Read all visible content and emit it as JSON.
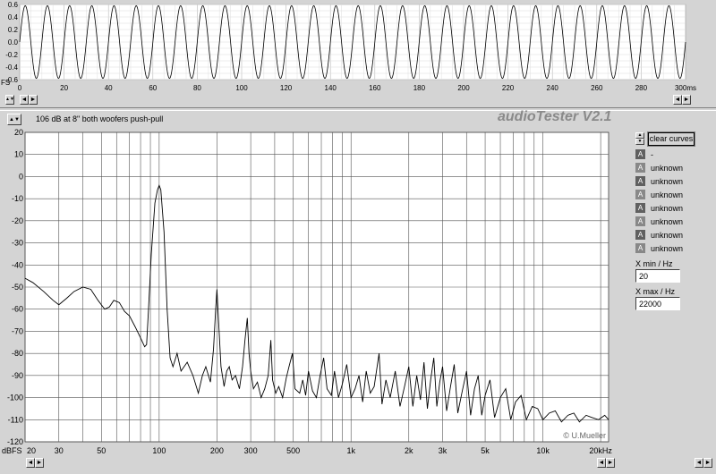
{
  "app": {
    "title": "audioTester V2.1",
    "chart_title": "106 dB at 8\" both woofers push-pull",
    "credit": "© U.Mueller"
  },
  "controls": {
    "clear_curves": "clear curves",
    "xmin_label": "X min / Hz",
    "xmin_value": "20",
    "xmax_label": "X max / Hz",
    "xmax_value": "22000"
  },
  "curves": [
    {
      "label": "-"
    },
    {
      "label": "unknown"
    },
    {
      "label": "unknown"
    },
    {
      "label": "unknown"
    },
    {
      "label": "unknown"
    },
    {
      "label": "unknown"
    },
    {
      "label": "unknown"
    },
    {
      "label": "unknown"
    }
  ],
  "icons": {
    "curve_toggle": "A",
    "scroll_left": "◄",
    "scroll_right": "►",
    "spin": "▲▼"
  },
  "chart_data": [
    {
      "type": "line",
      "name": "time-domain",
      "xunit": "300ms",
      "ylabel_top": "FS 0.6",
      "ylim": [
        -0.6,
        0.6
      ],
      "xlim": [
        0,
        300
      ],
      "yticks": [
        "0.6",
        "0.4",
        "0.2",
        "0.0",
        "-0.2",
        "-0.4",
        "-0.6"
      ],
      "xticks": [
        "0",
        "20",
        "40",
        "60",
        "80",
        "100",
        "120",
        "140",
        "160",
        "180",
        "200",
        "220",
        "240",
        "260",
        "280",
        "300ms"
      ],
      "signal": {
        "amplitude": 0.58,
        "frequency_hz": 100
      }
    },
    {
      "type": "line",
      "name": "spectrum",
      "xscale": "log",
      "xlim": [
        20,
        22000
      ],
      "ylim": [
        -120,
        20
      ],
      "ylabel": "dBFS",
      "yticks": [
        "20",
        "10",
        "0",
        "-10",
        "-20",
        "-30",
        "-40",
        "-50",
        "-60",
        "-70",
        "-80",
        "-90",
        "-100",
        "-110",
        "-120"
      ],
      "xtick_labels": [
        {
          "v": 20,
          "t": "20"
        },
        {
          "v": 30,
          "t": "30"
        },
        {
          "v": 50,
          "t": "50"
        },
        {
          "v": 100,
          "t": "100"
        },
        {
          "v": 200,
          "t": "200"
        },
        {
          "v": 300,
          "t": "300"
        },
        {
          "v": 500,
          "t": "500"
        },
        {
          "v": 1000,
          "t": "1k"
        },
        {
          "v": 2000,
          "t": "2k"
        },
        {
          "v": 3000,
          "t": "3k"
        },
        {
          "v": 5000,
          "t": "5k"
        },
        {
          "v": 10000,
          "t": "10k"
        },
        {
          "v": 20000,
          "t": "20kHz"
        }
      ],
      "points": [
        [
          20,
          -46
        ],
        [
          22,
          -48
        ],
        [
          25,
          -52
        ],
        [
          28,
          -56
        ],
        [
          30,
          -58
        ],
        [
          33,
          -55
        ],
        [
          36,
          -52
        ],
        [
          40,
          -50
        ],
        [
          44,
          -51
        ],
        [
          48,
          -56
        ],
        [
          52,
          -60
        ],
        [
          55,
          -59
        ],
        [
          58,
          -56
        ],
        [
          62,
          -57
        ],
        [
          66,
          -61
        ],
        [
          70,
          -63
        ],
        [
          75,
          -68
        ],
        [
          80,
          -73
        ],
        [
          84,
          -77
        ],
        [
          86,
          -76
        ],
        [
          88,
          -60
        ],
        [
          91,
          -35
        ],
        [
          95,
          -12
        ],
        [
          98,
          -6
        ],
        [
          100,
          -4
        ],
        [
          102,
          -6
        ],
        [
          106,
          -25
        ],
        [
          110,
          -60
        ],
        [
          114,
          -82
        ],
        [
          118,
          -86
        ],
        [
          124,
          -80
        ],
        [
          130,
          -88
        ],
        [
          140,
          -84
        ],
        [
          150,
          -90
        ],
        [
          160,
          -98
        ],
        [
          168,
          -90
        ],
        [
          175,
          -86
        ],
        [
          185,
          -93
        ],
        [
          192,
          -78
        ],
        [
          197,
          -60
        ],
        [
          200,
          -51
        ],
        [
          203,
          -62
        ],
        [
          210,
          -86
        ],
        [
          218,
          -95
        ],
        [
          225,
          -88
        ],
        [
          232,
          -86
        ],
        [
          240,
          -92
        ],
        [
          250,
          -90
        ],
        [
          262,
          -96
        ],
        [
          272,
          -86
        ],
        [
          280,
          -74
        ],
        [
          288,
          -64
        ],
        [
          294,
          -80
        ],
        [
          300,
          -88
        ],
        [
          310,
          -96
        ],
        [
          325,
          -93
        ],
        [
          340,
          -100
        ],
        [
          355,
          -96
        ],
        [
          370,
          -90
        ],
        [
          382,
          -74
        ],
        [
          390,
          -92
        ],
        [
          405,
          -98
        ],
        [
          420,
          -95
        ],
        [
          440,
          -100
        ],
        [
          460,
          -91
        ],
        [
          475,
          -86
        ],
        [
          495,
          -80
        ],
        [
          510,
          -96
        ],
        [
          540,
          -98
        ],
        [
          560,
          -92
        ],
        [
          580,
          -99
        ],
        [
          600,
          -88
        ],
        [
          630,
          -97
        ],
        [
          660,
          -100
        ],
        [
          690,
          -90
        ],
        [
          720,
          -82
        ],
        [
          750,
          -96
        ],
        [
          790,
          -99
        ],
        [
          820,
          -88
        ],
        [
          860,
          -100
        ],
        [
          900,
          -94
        ],
        [
          950,
          -85
        ],
        [
          1000,
          -100
        ],
        [
          1050,
          -96
        ],
        [
          1100,
          -90
        ],
        [
          1150,
          -102
        ],
        [
          1200,
          -88
        ],
        [
          1260,
          -98
        ],
        [
          1320,
          -95
        ],
        [
          1400,
          -80
        ],
        [
          1450,
          -103
        ],
        [
          1520,
          -92
        ],
        [
          1600,
          -100
        ],
        [
          1700,
          -88
        ],
        [
          1800,
          -104
        ],
        [
          1900,
          -95
        ],
        [
          2000,
          -86
        ],
        [
          2100,
          -104
        ],
        [
          2200,
          -90
        ],
        [
          2300,
          -101
        ],
        [
          2400,
          -84
        ],
        [
          2500,
          -105
        ],
        [
          2600,
          -92
        ],
        [
          2700,
          -82
        ],
        [
          2800,
          -104
        ],
        [
          2900,
          -93
        ],
        [
          3000,
          -86
        ],
        [
          3150,
          -106
        ],
        [
          3300,
          -95
        ],
        [
          3450,
          -85
        ],
        [
          3600,
          -107
        ],
        [
          3800,
          -97
        ],
        [
          4000,
          -88
        ],
        [
          4200,
          -108
        ],
        [
          4400,
          -96
        ],
        [
          4600,
          -90
        ],
        [
          4800,
          -108
        ],
        [
          5000,
          -99
        ],
        [
          5300,
          -92
        ],
        [
          5600,
          -109
        ],
        [
          6000,
          -100
        ],
        [
          6400,
          -96
        ],
        [
          6800,
          -110
        ],
        [
          7200,
          -102
        ],
        [
          7700,
          -99
        ],
        [
          8200,
          -110
        ],
        [
          8800,
          -104
        ],
        [
          9400,
          -105
        ],
        [
          10000,
          -110
        ],
        [
          10800,
          -107
        ],
        [
          11600,
          -106
        ],
        [
          12500,
          -111
        ],
        [
          13500,
          -108
        ],
        [
          14500,
          -107
        ],
        [
          15500,
          -111
        ],
        [
          16800,
          -108
        ],
        [
          18000,
          -109
        ],
        [
          19500,
          -110
        ],
        [
          21000,
          -108
        ],
        [
          22000,
          -110
        ]
      ]
    }
  ]
}
